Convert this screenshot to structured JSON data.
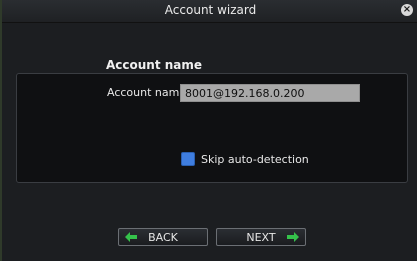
{
  "window": {
    "title": "Account wizard"
  },
  "section": {
    "title": "Account name"
  },
  "form": {
    "account_label": "Account name",
    "account_value": "8001@192.168.0.200",
    "skip_label": "Skip auto-detection",
    "skip_checked": true
  },
  "buttons": {
    "back_label": "BACK",
    "next_label": "NEXT"
  },
  "icons": {
    "close": "close-icon",
    "back_arrow": "arrow-left-icon",
    "next_arrow": "arrow-right-icon"
  },
  "colors": {
    "accent_green": "#35c24b",
    "checkbox_blue": "#3f7ee0"
  }
}
